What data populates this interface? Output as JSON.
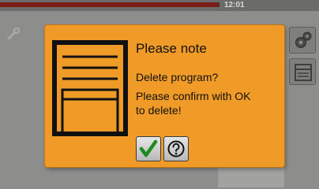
{
  "status_bar": {
    "time": "12:01",
    "progress_fraction": 0.99
  },
  "dialog": {
    "title": "Please note",
    "message_line1": "Delete program?",
    "message_line2": "Please confirm with OK",
    "message_line3": "to delete!",
    "icons": {
      "illustration": "door-panel-icon",
      "ok": "checkmark-icon",
      "help": "question-mark-icon"
    }
  },
  "sidebar": {
    "icons": [
      "settings-gears-icon",
      "document-list-icon"
    ]
  },
  "colors": {
    "dialog_background": "#f09a28",
    "checkmark": "#1f8a1f",
    "progress": "#7c1c17"
  }
}
